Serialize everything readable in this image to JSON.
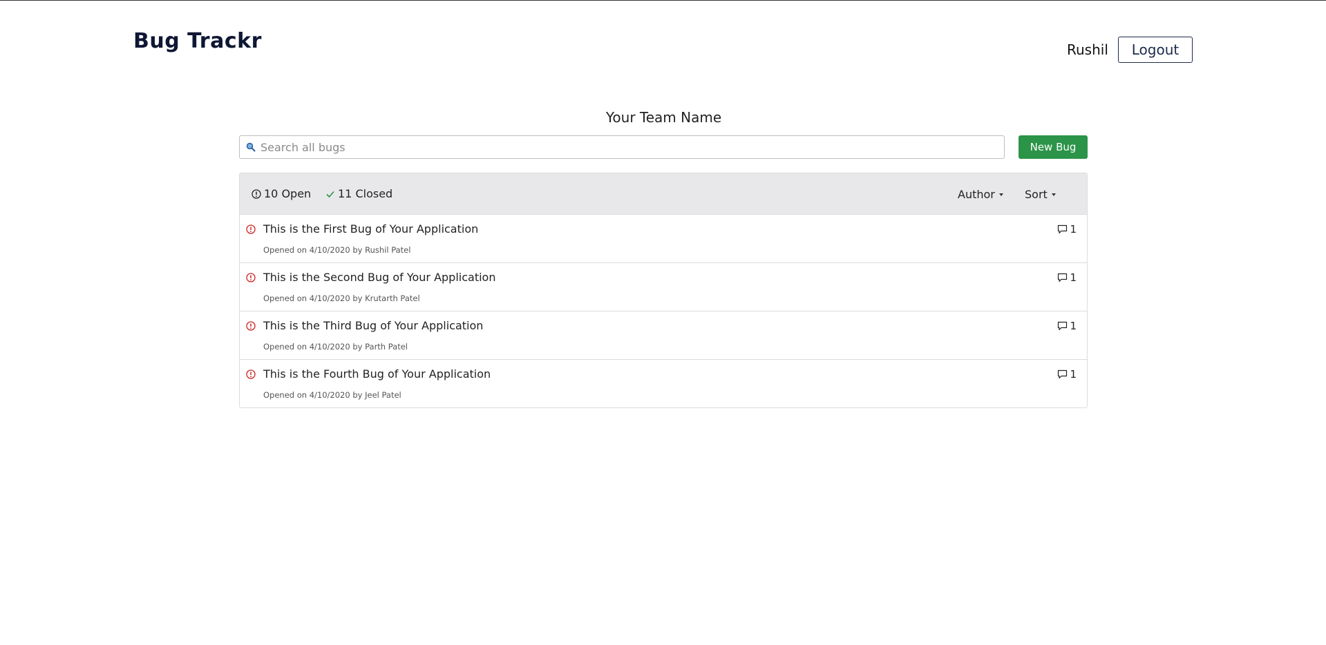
{
  "header": {
    "brand": "Bug Trackr",
    "user": "Rushil",
    "logout_label": "Logout"
  },
  "team": {
    "name": "Your Team Name"
  },
  "search": {
    "placeholder": "Search all bugs",
    "value": ""
  },
  "actions": {
    "new_bug_label": "New Bug"
  },
  "colors": {
    "brand": "#0e1733",
    "new_bug_button": "#2b9448",
    "open_icon": "#cc2222",
    "closed_check": "#2b9448",
    "header_bg": "#e8e8ea"
  },
  "list_header": {
    "open_count": "10 Open",
    "closed_count": "11 Closed",
    "author_label": "Author",
    "sort_label": "Sort"
  },
  "bugs": [
    {
      "title": "This is the First Bug of Your Application",
      "meta": "Opened on 4/10/2020 by Rushil Patel",
      "comments": "1",
      "icon": "open-issue-icon"
    },
    {
      "title": "This is the Second Bug of Your Application",
      "meta": "Opened on 4/10/2020 by Krutarth Patel",
      "comments": "1",
      "icon": "open-issue-icon"
    },
    {
      "title": "This is the Third Bug of Your Application",
      "meta": "Opened on 4/10/2020 by Parth Patel",
      "comments": "1",
      "icon": "open-issue-icon"
    },
    {
      "title": "This is the Fourth Bug of Your Application",
      "meta": "Opened on 4/10/2020 by Jeel Patel",
      "comments": "1",
      "icon": "open-issue-icon"
    }
  ]
}
